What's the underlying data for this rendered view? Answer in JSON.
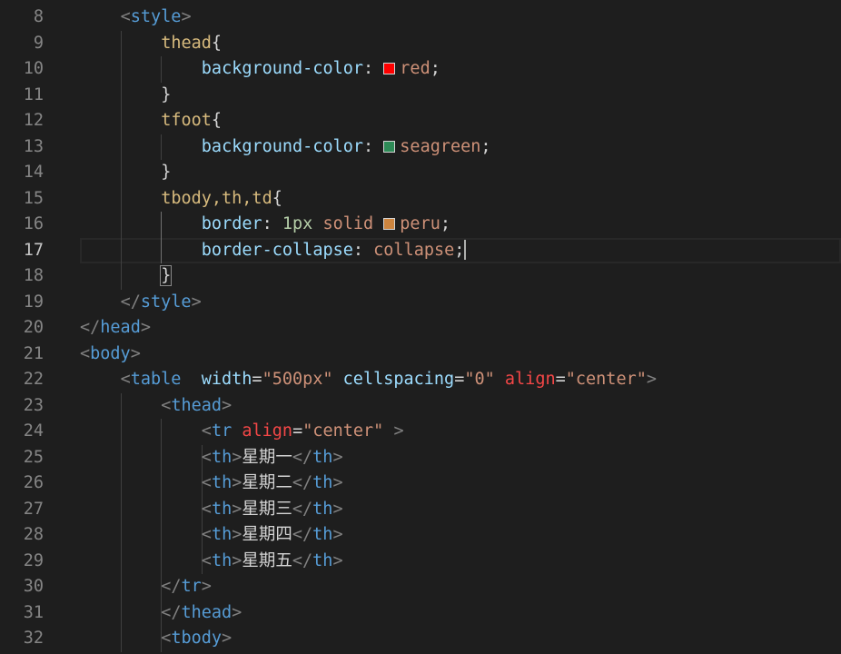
{
  "editor": {
    "active_line": "17",
    "lines": [
      {
        "num": "8",
        "code": [
          {
            "t": "<",
            "c": "punc"
          },
          {
            "t": "style",
            "c": "tag"
          },
          {
            "t": ">",
            "c": "punc"
          }
        ]
      },
      {
        "num": "9",
        "code": [
          {
            "t": "thead",
            "c": "sel"
          },
          {
            "t": "{",
            "c": "txt"
          }
        ]
      },
      {
        "num": "10",
        "code": [
          {
            "t": "background-color",
            "c": "prop"
          },
          {
            "t": ": ",
            "c": "txt"
          },
          {
            "swatch": "#ff0000"
          },
          {
            "t": "red",
            "c": "val"
          },
          {
            "t": ";",
            "c": "txt"
          }
        ]
      },
      {
        "num": "11",
        "code": [
          {
            "t": "}",
            "c": "txt"
          }
        ]
      },
      {
        "num": "12",
        "code": [
          {
            "t": "tfoot",
            "c": "sel"
          },
          {
            "t": "{",
            "c": "txt"
          }
        ]
      },
      {
        "num": "13",
        "code": [
          {
            "t": "background-color",
            "c": "prop"
          },
          {
            "t": ": ",
            "c": "txt"
          },
          {
            "swatch": "#2e8b57"
          },
          {
            "t": "seagreen",
            "c": "val"
          },
          {
            "t": ";",
            "c": "txt"
          }
        ]
      },
      {
        "num": "14",
        "code": [
          {
            "t": "}",
            "c": "txt"
          }
        ]
      },
      {
        "num": "15",
        "code": [
          {
            "t": "tbody,th,td",
            "c": "sel"
          },
          {
            "t": "{",
            "c": "txt"
          }
        ]
      },
      {
        "num": "16",
        "code": [
          {
            "t": "border",
            "c": "prop"
          },
          {
            "t": ": ",
            "c": "txt"
          },
          {
            "t": "1px",
            "c": "num"
          },
          {
            "t": " solid ",
            "c": "val"
          },
          {
            "swatch": "#cd853f"
          },
          {
            "t": "peru",
            "c": "val"
          },
          {
            "t": ";",
            "c": "txt"
          }
        ]
      },
      {
        "num": "17",
        "code": [
          {
            "t": "border-collapse",
            "c": "prop"
          },
          {
            "t": ": ",
            "c": "txt"
          },
          {
            "t": "collapse",
            "c": "val"
          },
          {
            "t": ";",
            "c": "txt"
          },
          {
            "cursor": true
          }
        ]
      },
      {
        "num": "18",
        "code": [
          {
            "t": "}",
            "c": "txt",
            "box": true
          }
        ]
      },
      {
        "num": "19",
        "code": [
          {
            "t": "</",
            "c": "punc"
          },
          {
            "t": "style",
            "c": "tag"
          },
          {
            "t": ">",
            "c": "punc"
          }
        ]
      },
      {
        "num": "20",
        "code": [
          {
            "t": "</",
            "c": "punc"
          },
          {
            "t": "head",
            "c": "tag"
          },
          {
            "t": ">",
            "c": "punc"
          }
        ]
      },
      {
        "num": "21",
        "code": [
          {
            "t": "<",
            "c": "punc"
          },
          {
            "t": "body",
            "c": "tag"
          },
          {
            "t": ">",
            "c": "punc"
          }
        ]
      },
      {
        "num": "22",
        "code": [
          {
            "t": "<",
            "c": "punc"
          },
          {
            "t": "table",
            "c": "tag"
          },
          {
            "t": "  ",
            "c": "txt"
          },
          {
            "t": "width",
            "c": "attr"
          },
          {
            "t": "=",
            "c": "txt"
          },
          {
            "t": "\"500px\"",
            "c": "str"
          },
          {
            "t": " ",
            "c": "txt"
          },
          {
            "t": "cellspacing",
            "c": "attr"
          },
          {
            "t": "=",
            "c": "txt"
          },
          {
            "t": "\"0\"",
            "c": "str"
          },
          {
            "t": " ",
            "c": "txt"
          },
          {
            "t": "align",
            "c": "attr-warn"
          },
          {
            "t": "=",
            "c": "txt"
          },
          {
            "t": "\"center\"",
            "c": "str"
          },
          {
            "t": ">",
            "c": "punc"
          }
        ]
      },
      {
        "num": "23",
        "code": [
          {
            "t": "<",
            "c": "punc"
          },
          {
            "t": "thead",
            "c": "tag"
          },
          {
            "t": ">",
            "c": "punc"
          }
        ]
      },
      {
        "num": "24",
        "code": [
          {
            "t": "<",
            "c": "punc"
          },
          {
            "t": "tr",
            "c": "tag"
          },
          {
            "t": " ",
            "c": "txt"
          },
          {
            "t": "align",
            "c": "attr-warn"
          },
          {
            "t": "=",
            "c": "txt"
          },
          {
            "t": "\"center\"",
            "c": "str"
          },
          {
            "t": " ",
            "c": "txt"
          },
          {
            "t": ">",
            "c": "punc"
          }
        ]
      },
      {
        "num": "25",
        "code": [
          {
            "t": "<",
            "c": "punc"
          },
          {
            "t": "th",
            "c": "tag"
          },
          {
            "t": ">",
            "c": "punc"
          },
          {
            "t": "星期一",
            "c": "txt"
          },
          {
            "t": "</",
            "c": "punc"
          },
          {
            "t": "th",
            "c": "tag"
          },
          {
            "t": ">",
            "c": "punc"
          }
        ]
      },
      {
        "num": "26",
        "code": [
          {
            "t": "<",
            "c": "punc"
          },
          {
            "t": "th",
            "c": "tag"
          },
          {
            "t": ">",
            "c": "punc"
          },
          {
            "t": "星期二",
            "c": "txt"
          },
          {
            "t": "</",
            "c": "punc"
          },
          {
            "t": "th",
            "c": "tag"
          },
          {
            "t": ">",
            "c": "punc"
          }
        ]
      },
      {
        "num": "27",
        "code": [
          {
            "t": "<",
            "c": "punc"
          },
          {
            "t": "th",
            "c": "tag"
          },
          {
            "t": ">",
            "c": "punc"
          },
          {
            "t": "星期三",
            "c": "txt"
          },
          {
            "t": "</",
            "c": "punc"
          },
          {
            "t": "th",
            "c": "tag"
          },
          {
            "t": ">",
            "c": "punc"
          }
        ]
      },
      {
        "num": "28",
        "code": [
          {
            "t": "<",
            "c": "punc"
          },
          {
            "t": "th",
            "c": "tag"
          },
          {
            "t": ">",
            "c": "punc"
          },
          {
            "t": "星期四",
            "c": "txt"
          },
          {
            "t": "</",
            "c": "punc"
          },
          {
            "t": "th",
            "c": "tag"
          },
          {
            "t": ">",
            "c": "punc"
          }
        ]
      },
      {
        "num": "29",
        "code": [
          {
            "t": "<",
            "c": "punc"
          },
          {
            "t": "th",
            "c": "tag"
          },
          {
            "t": ">",
            "c": "punc"
          },
          {
            "t": "星期五",
            "c": "txt"
          },
          {
            "t": "</",
            "c": "punc"
          },
          {
            "t": "th",
            "c": "tag"
          },
          {
            "t": ">",
            "c": "punc"
          }
        ]
      },
      {
        "num": "30",
        "code": [
          {
            "t": "</",
            "c": "punc"
          },
          {
            "t": "tr",
            "c": "tag"
          },
          {
            "t": ">",
            "c": "punc"
          }
        ]
      },
      {
        "num": "31",
        "code": [
          {
            "t": "</",
            "c": "punc"
          },
          {
            "t": "thead",
            "c": "tag"
          },
          {
            "t": ">",
            "c": "punc"
          }
        ]
      },
      {
        "num": "32",
        "code": [
          {
            "t": "<",
            "c": "punc"
          },
          {
            "t": "tbody",
            "c": "tag"
          },
          {
            "t": ">",
            "c": "punc"
          }
        ]
      }
    ]
  }
}
